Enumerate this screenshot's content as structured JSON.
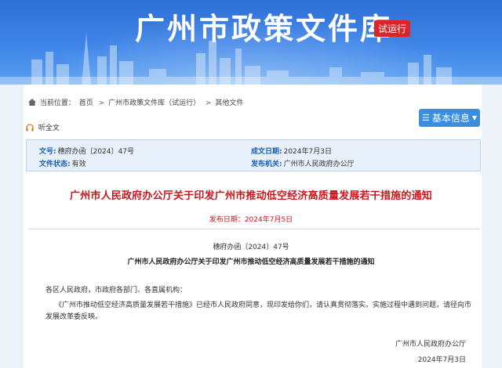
{
  "banner": {
    "site_title": "广州市政策文件库",
    "trial_badge": "试运行"
  },
  "breadcrumb": {
    "prefix": "当前位置：",
    "items": [
      "首页",
      "广州市政策文件库（试运行）",
      "其他文件"
    ],
    "separator": ">"
  },
  "toolbar": {
    "listen_label": "听全文",
    "info_button_label": "基本信息"
  },
  "meta": {
    "doc_number_label": "文号:",
    "doc_number_value": "穗府办函〔2024〕47号",
    "release_date_label": "成文日期:",
    "release_date_value": "2024年7月3日",
    "status_label": "文件状态:",
    "status_value": "有效",
    "issuer_label": "发布机关:",
    "issuer_value": "广州市人民政府办公厅"
  },
  "document": {
    "title": "广州市人民政府办公厅关于印发广州市推动低空经济高质量发展若干措施的通知",
    "publish_date": "发布日期：2024年7月5日",
    "doc_number": "穗府办函〔2024〕47号",
    "subtitle": "广州市人民政府办公厅关于印发广州市推动低空经济高质量发展若干措施的通知",
    "addressee": "各区人民政府，市政府各部门、各直属机构：",
    "body": "《广州市推动低空经济高质量发展若干措施》已经市人民政府同意，现印发给你们，请认真贯彻落实。实施过程中遇到问题，请径向市发展改革委反映。",
    "signer": "广州市人民政府办公厅",
    "sign_date": "2024年7月3日"
  },
  "colors": {
    "banner_blue": "#3f86e8",
    "title_red": "#c8161d",
    "badge_red": "#d9262a",
    "button_blue": "#3b8de0",
    "meta_bg": "#e7f0fb",
    "meta_label": "#1a5fb4"
  },
  "icons": {
    "breadcrumb": "home-icon",
    "listen": "headphones-icon",
    "info_button": "list-icon",
    "info_caret": "chevron-down-icon"
  }
}
